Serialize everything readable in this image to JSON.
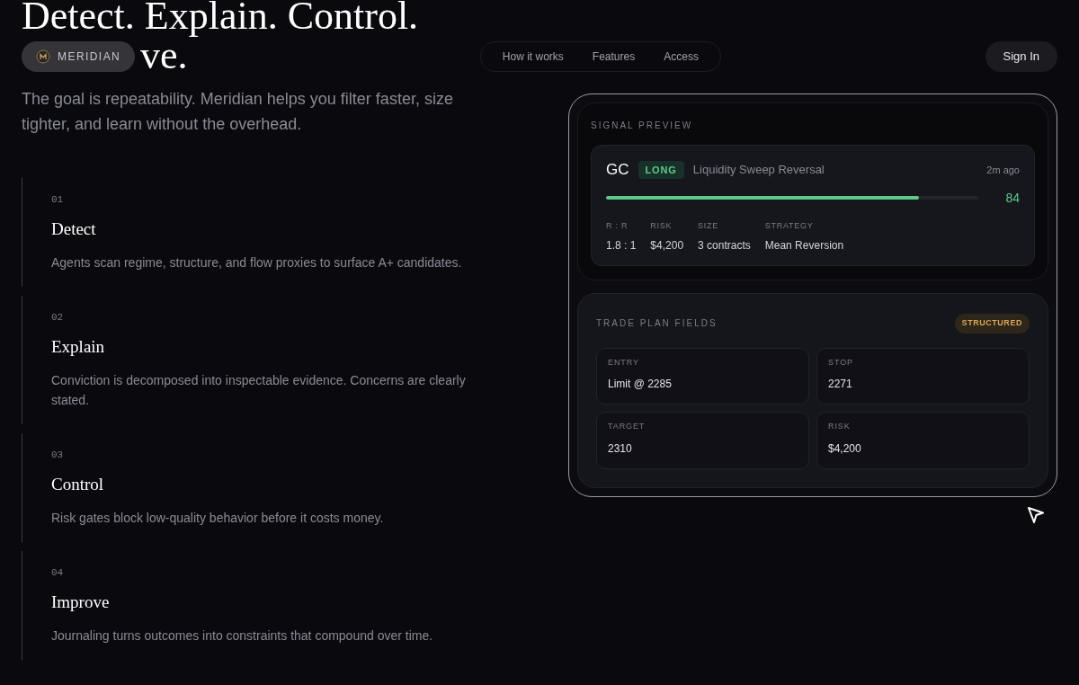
{
  "heading": {
    "line_1": "Detect. Explain. Control.",
    "line_2": "ve."
  },
  "nav": {
    "brand": "MERIDIAN",
    "links": [
      "How it works",
      "Features",
      "Access"
    ],
    "sign_in": "Sign In"
  },
  "intro": "The goal is repeatability. Meridian helps you filter faster, size tighter, and learn without the overhead.",
  "steps": [
    {
      "number": "01",
      "title": "Detect",
      "text": "Agents scan regime, structure, and flow proxies to surface A+ candidates."
    },
    {
      "number": "02",
      "title": "Explain",
      "text": "Conviction is decomposed into inspectable evidence. Concerns are clearly stated."
    },
    {
      "number": "03",
      "title": "Control",
      "text": "Risk gates block low-quality behavior before it costs money."
    },
    {
      "number": "04",
      "title": "Improve",
      "text": "Journaling turns outcomes into constraints that compound over time."
    }
  ],
  "signal_preview": {
    "label": "SIGNAL PREVIEW",
    "symbol": "GC",
    "direction": "LONG",
    "setup": "Liquidity Sweep Reversal",
    "time": "2m ago",
    "level": 0.84,
    "score": "84",
    "stats": [
      {
        "label": "R : R",
        "value": "1.8 : 1"
      },
      {
        "label": "RISK",
        "value": "$4,200"
      },
      {
        "label": "SIZE",
        "value": "3 contracts"
      },
      {
        "label": "STRATEGY",
        "value": "Mean Reversion"
      }
    ]
  },
  "trade_plan": {
    "label": "TRADE PLAN FIELDS",
    "badge": "STRUCTURED",
    "fields": [
      {
        "label": "ENTRY",
        "value": "Limit @ 2285"
      },
      {
        "label": "STOP",
        "value": "2271"
      },
      {
        "label": "TARGET",
        "value": "2310"
      },
      {
        "label": "RISK",
        "value": "$4,200"
      }
    ]
  }
}
